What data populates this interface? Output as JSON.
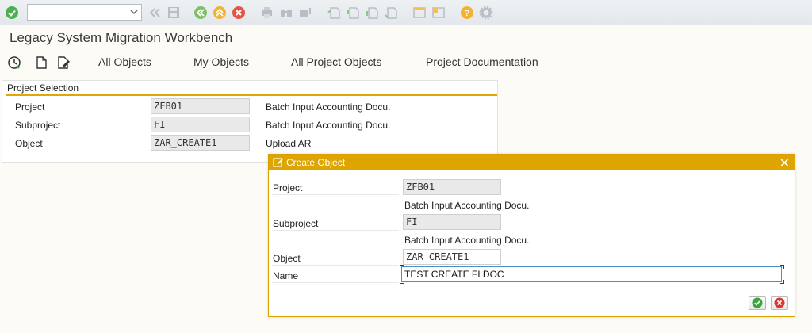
{
  "colors": {
    "accent": "#dea500",
    "confirm": "#3aa53a",
    "cancel": "#d9382e"
  },
  "system_toolbar": {
    "command_field": "",
    "icons": [
      "enter-icon",
      "back-icon",
      "save-icon",
      "back-green-icon",
      "exit-icon",
      "cancel-icon",
      "print-icon",
      "find-icon",
      "find-next-icon",
      "first-page-icon",
      "previous-page-icon",
      "next-page-icon",
      "last-page-icon",
      "new-session-icon",
      "shortcut-icon",
      "help-icon",
      "settings-icon"
    ]
  },
  "title": "Legacy System Migration Workbench",
  "app_toolbar": {
    "icons": [
      "execute-icon",
      "create-document-icon",
      "edit-document-icon"
    ],
    "buttons": [
      "All Objects",
      "My Objects",
      "All Project Objects",
      "Project Documentation"
    ]
  },
  "project_selection": {
    "title": "Project Selection",
    "rows": [
      {
        "label": "Project",
        "value": "ZFB01",
        "desc": "Batch Input Accounting Docu."
      },
      {
        "label": "Subproject",
        "value": "FI",
        "desc": "Batch Input Accounting Docu."
      },
      {
        "label": "Object",
        "value": "ZAR_CREATE1",
        "desc": "Upload AR"
      }
    ]
  },
  "dialog": {
    "title": "Create Object",
    "project_label": "Project",
    "project_value": "ZFB01",
    "project_desc": "Batch Input Accounting Docu.",
    "subproject_label": "Subproject",
    "subproject_value": "FI",
    "subproject_desc": "Batch Input Accounting Docu.",
    "object_label": "Object",
    "object_value": "ZAR_CREATE1",
    "name_label": "Name",
    "name_value": "TEST CREATE FI DOC"
  }
}
